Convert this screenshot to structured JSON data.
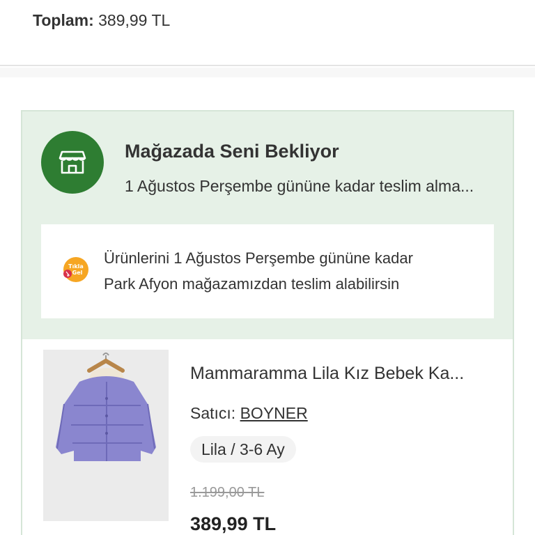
{
  "summary": {
    "total_label": "Toplam:",
    "total_value": "389,99 TL"
  },
  "pickup": {
    "title": "Mağazada Seni Bekliyor",
    "subtitle": "1 Ağustos Perşembe gününe kadar teslim alma...",
    "store_icon": "store-icon",
    "accent_color": "#2e7d32",
    "panel_color": "#e6f1e7"
  },
  "notice": {
    "badge": "Tıkla Gel",
    "line1": "Ürünlerini 1 Ağustos Perşembe gününe kadar",
    "line2": "Park Afyon mağazamızdan teslim alabilirsin"
  },
  "product": {
    "name": "Mammaramma Lila Kız Bebek Ka...",
    "seller_label": "Satıcı:",
    "seller_name": "BOYNER",
    "variant": "Lila / 3-6 Ay",
    "old_price": "1.199,00 TL",
    "price": "389,99 TL",
    "image": "lilac-puffer-jacket"
  }
}
